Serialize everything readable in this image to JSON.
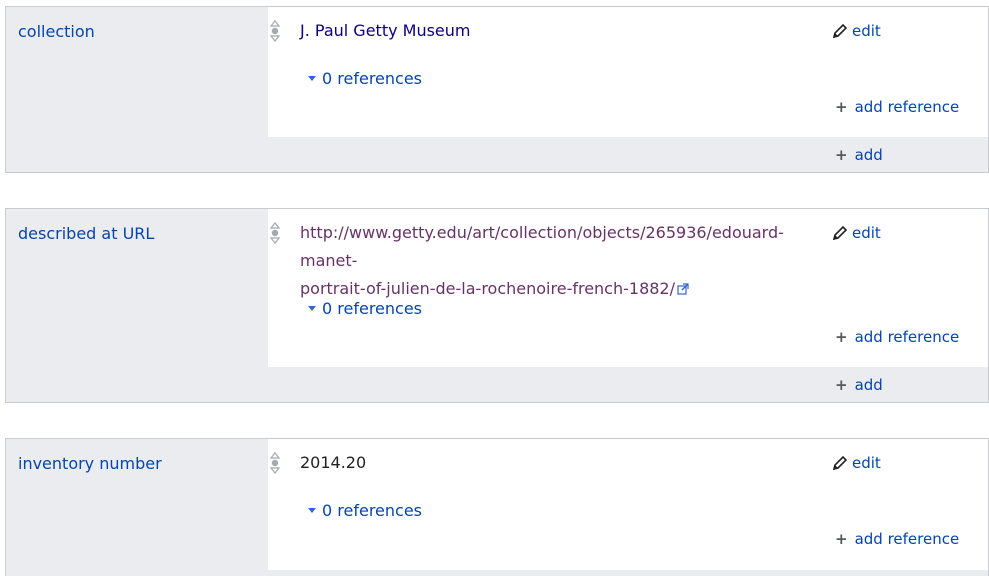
{
  "statements": [
    {
      "property": "collection",
      "value": "J. Paul Getty Museum",
      "value_type": "item",
      "edit": "edit",
      "references": "0 references",
      "add_reference": "add reference",
      "add": "add"
    },
    {
      "property": "described at URL",
      "value_line1": "http://www.getty.edu/art/collection/objects/265936/edouard-manet-",
      "value_line2": "portrait-of-julien-de-la-rochenoire-french-1882/",
      "value_type": "url",
      "edit": "edit",
      "references": "0 references",
      "add_reference": "add reference",
      "add": "add"
    },
    {
      "property": "inventory number",
      "value": "2014.20",
      "value_type": "string",
      "edit": "edit",
      "references": "0 references",
      "add_reference": "add reference"
    }
  ],
  "colors": {
    "link": "#0645ad",
    "item_link": "#0b0080",
    "visited_url": "#663366",
    "group_bg": "#eaecf0",
    "border": "#c8ccd1"
  },
  "icons": {
    "rank": "normal-rank-icon",
    "edit": "pencil-icon",
    "external": "external-link-icon",
    "toggle": "triangle-down-icon",
    "add": "plus-icon"
  }
}
